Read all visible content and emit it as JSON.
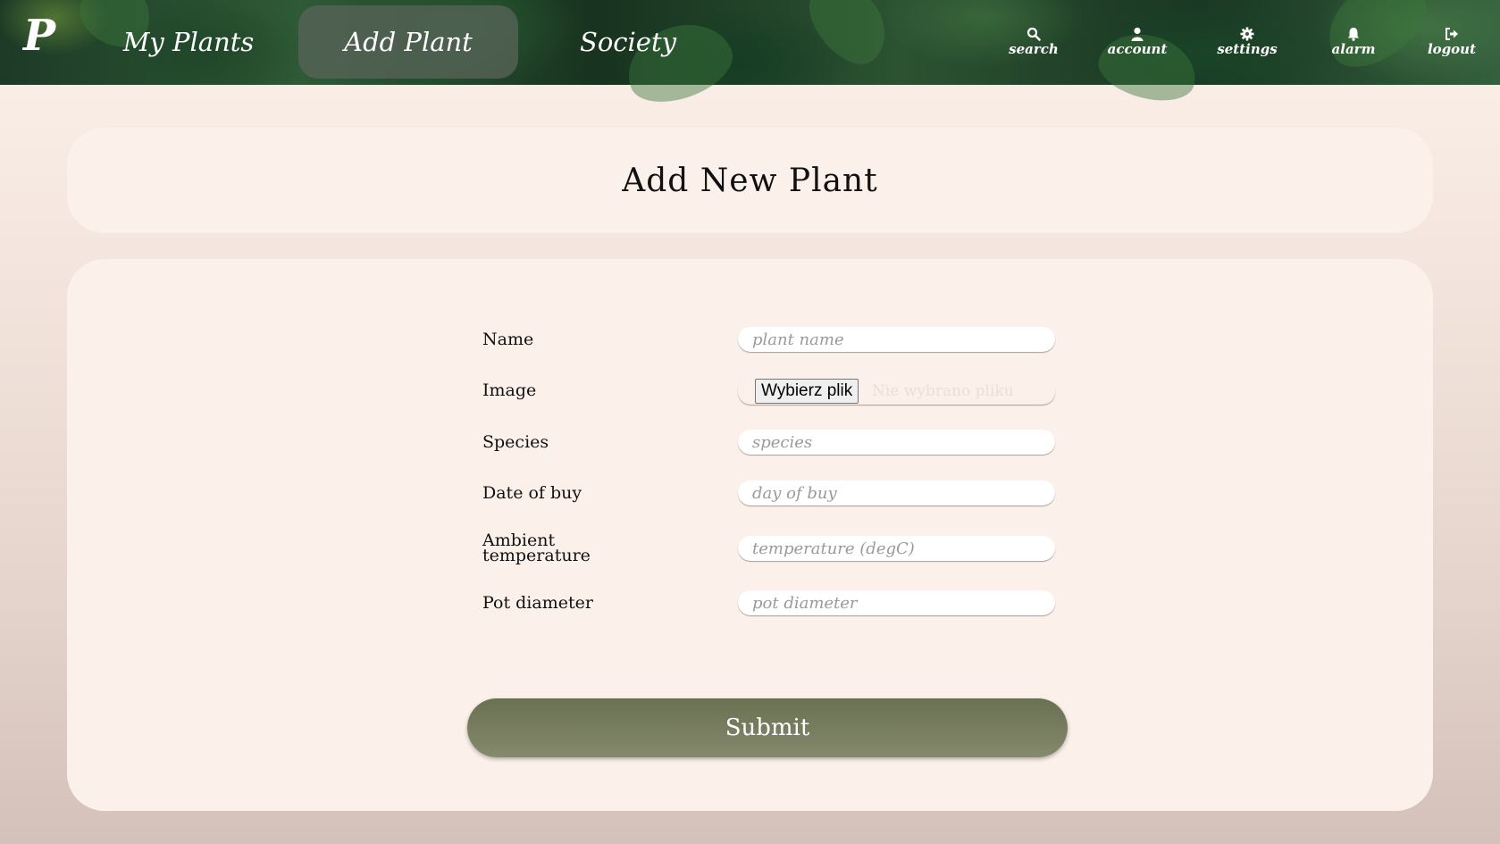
{
  "nav": {
    "logo": "P",
    "tabs": [
      {
        "label": "My Plants"
      },
      {
        "label": "Add Plant"
      },
      {
        "label": "Society"
      }
    ],
    "icons": [
      {
        "label": "search",
        "icon": "search-icon"
      },
      {
        "label": "account",
        "icon": "user-icon"
      },
      {
        "label": "settings",
        "icon": "gear-icon"
      },
      {
        "label": "alarm",
        "icon": "bell-icon"
      },
      {
        "label": "logout",
        "icon": "logout-icon"
      }
    ]
  },
  "page": {
    "title": "Add New Plant"
  },
  "form": {
    "name": {
      "label": "Name",
      "placeholder": "plant name",
      "value": ""
    },
    "image": {
      "label": "Image",
      "button": "Wybierz plik",
      "status": "Nie wybrano pliku"
    },
    "species": {
      "label": "Species",
      "placeholder": "species",
      "value": ""
    },
    "date": {
      "label": "Date of buy",
      "placeholder": "day of buy",
      "value": ""
    },
    "temperature": {
      "label_line1": "Ambient",
      "label_line2": "temperature",
      "placeholder": "temperature (degC)",
      "value": ""
    },
    "pot": {
      "label": "Pot diameter",
      "placeholder": "pot diameter",
      "value": ""
    },
    "submit": "Submit"
  },
  "colors": {
    "accent": "#6f7457",
    "card": "#fcf1ea"
  }
}
